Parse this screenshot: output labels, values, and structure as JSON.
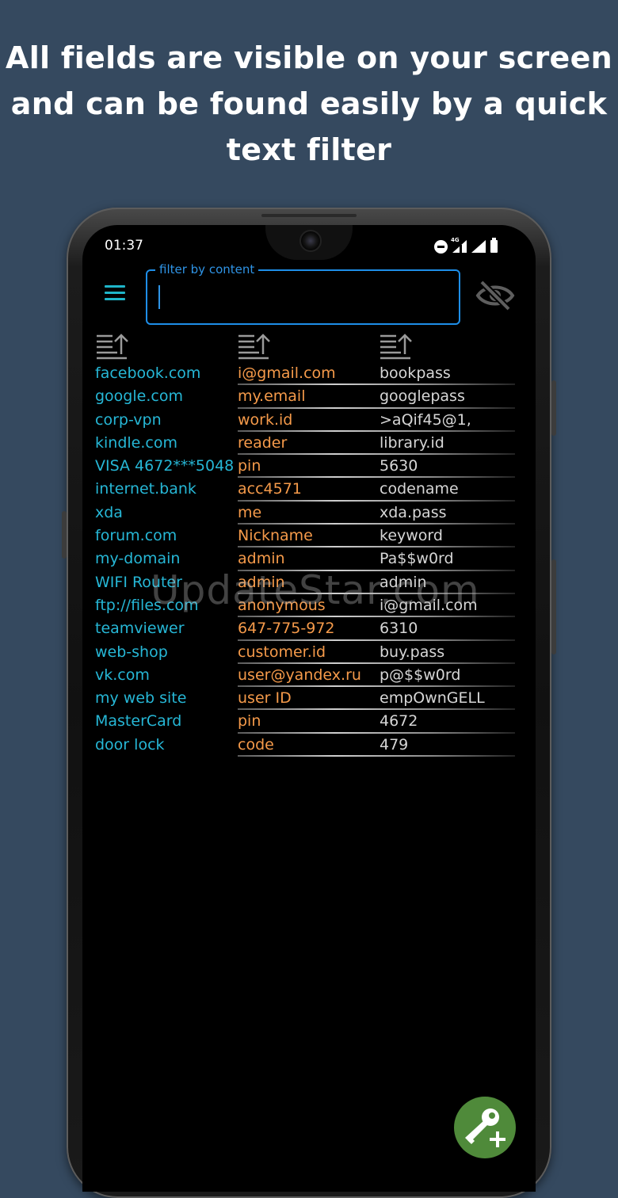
{
  "headline": {
    "line1": "All fields are visible  on your screen",
    "line2": "and can be found easily by a quick",
    "line3": "text filter"
  },
  "status_bar": {
    "time": "01:37",
    "network": "4G",
    "icons": [
      "do-not-disturb-icon",
      "signal-icon",
      "signal-icon",
      "battery-icon"
    ]
  },
  "app_bar": {
    "menu_icon": "hamburger-menu-icon",
    "filter": {
      "label": "filter by content",
      "value": ""
    },
    "visibility_icon": "eye-off-icon"
  },
  "columns": {
    "sort_icon": "sort-ascending-icon",
    "count": 3
  },
  "rows": [
    {
      "site": "facebook.com",
      "login": "i@gmail.com",
      "password": "bookpass"
    },
    {
      "site": "google.com",
      "login": "my.email",
      "password": "googlepass"
    },
    {
      "site": "corp-vpn",
      "login": "work.id",
      "password": ">aQif45@1,"
    },
    {
      "site": "kindle.com",
      "login": "reader",
      "password": "library.id"
    },
    {
      "site": "VISA 4672***5048",
      "login": "pin",
      "password": "5630"
    },
    {
      "site": "internet.bank",
      "login": "acc4571",
      "password": "codename"
    },
    {
      "site": "xda",
      "login": "me",
      "password": "xda.pass"
    },
    {
      "site": "forum.com",
      "login": "Nickname",
      "password": "keyword"
    },
    {
      "site": "my-domain",
      "login": "admin",
      "password": "Pa$$w0rd"
    },
    {
      "site": "WIFI Router",
      "login": "admin",
      "password": "admin"
    },
    {
      "site": "ftp://files.com",
      "login": "anonymous",
      "password": "i@gmail.com"
    },
    {
      "site": "teamviewer",
      "login": "647-775-972",
      "password": "6310"
    },
    {
      "site": "web-shop",
      "login": "customer.id",
      "password": "buy.pass"
    },
    {
      "site": "vk.com",
      "login": "user@yandex.ru",
      "password": "p@$$w0rd"
    },
    {
      "site": "my web site",
      "login": "user ID",
      "password": "empOwnGELL"
    },
    {
      "site": "MasterCard",
      "login": "pin",
      "password": "4672"
    },
    {
      "site": "door lock",
      "login": "code",
      "password": "479"
    }
  ],
  "watermark": "UpdateStar.com",
  "fab": {
    "icon": "key-add-icon"
  },
  "colors": {
    "background": "#35495f",
    "site_text": "#26b7d6",
    "login_text": "#f59a4a",
    "password_text": "#d6d6d6",
    "accent": "#1e8ee8",
    "fab": "#4f8a3a"
  }
}
